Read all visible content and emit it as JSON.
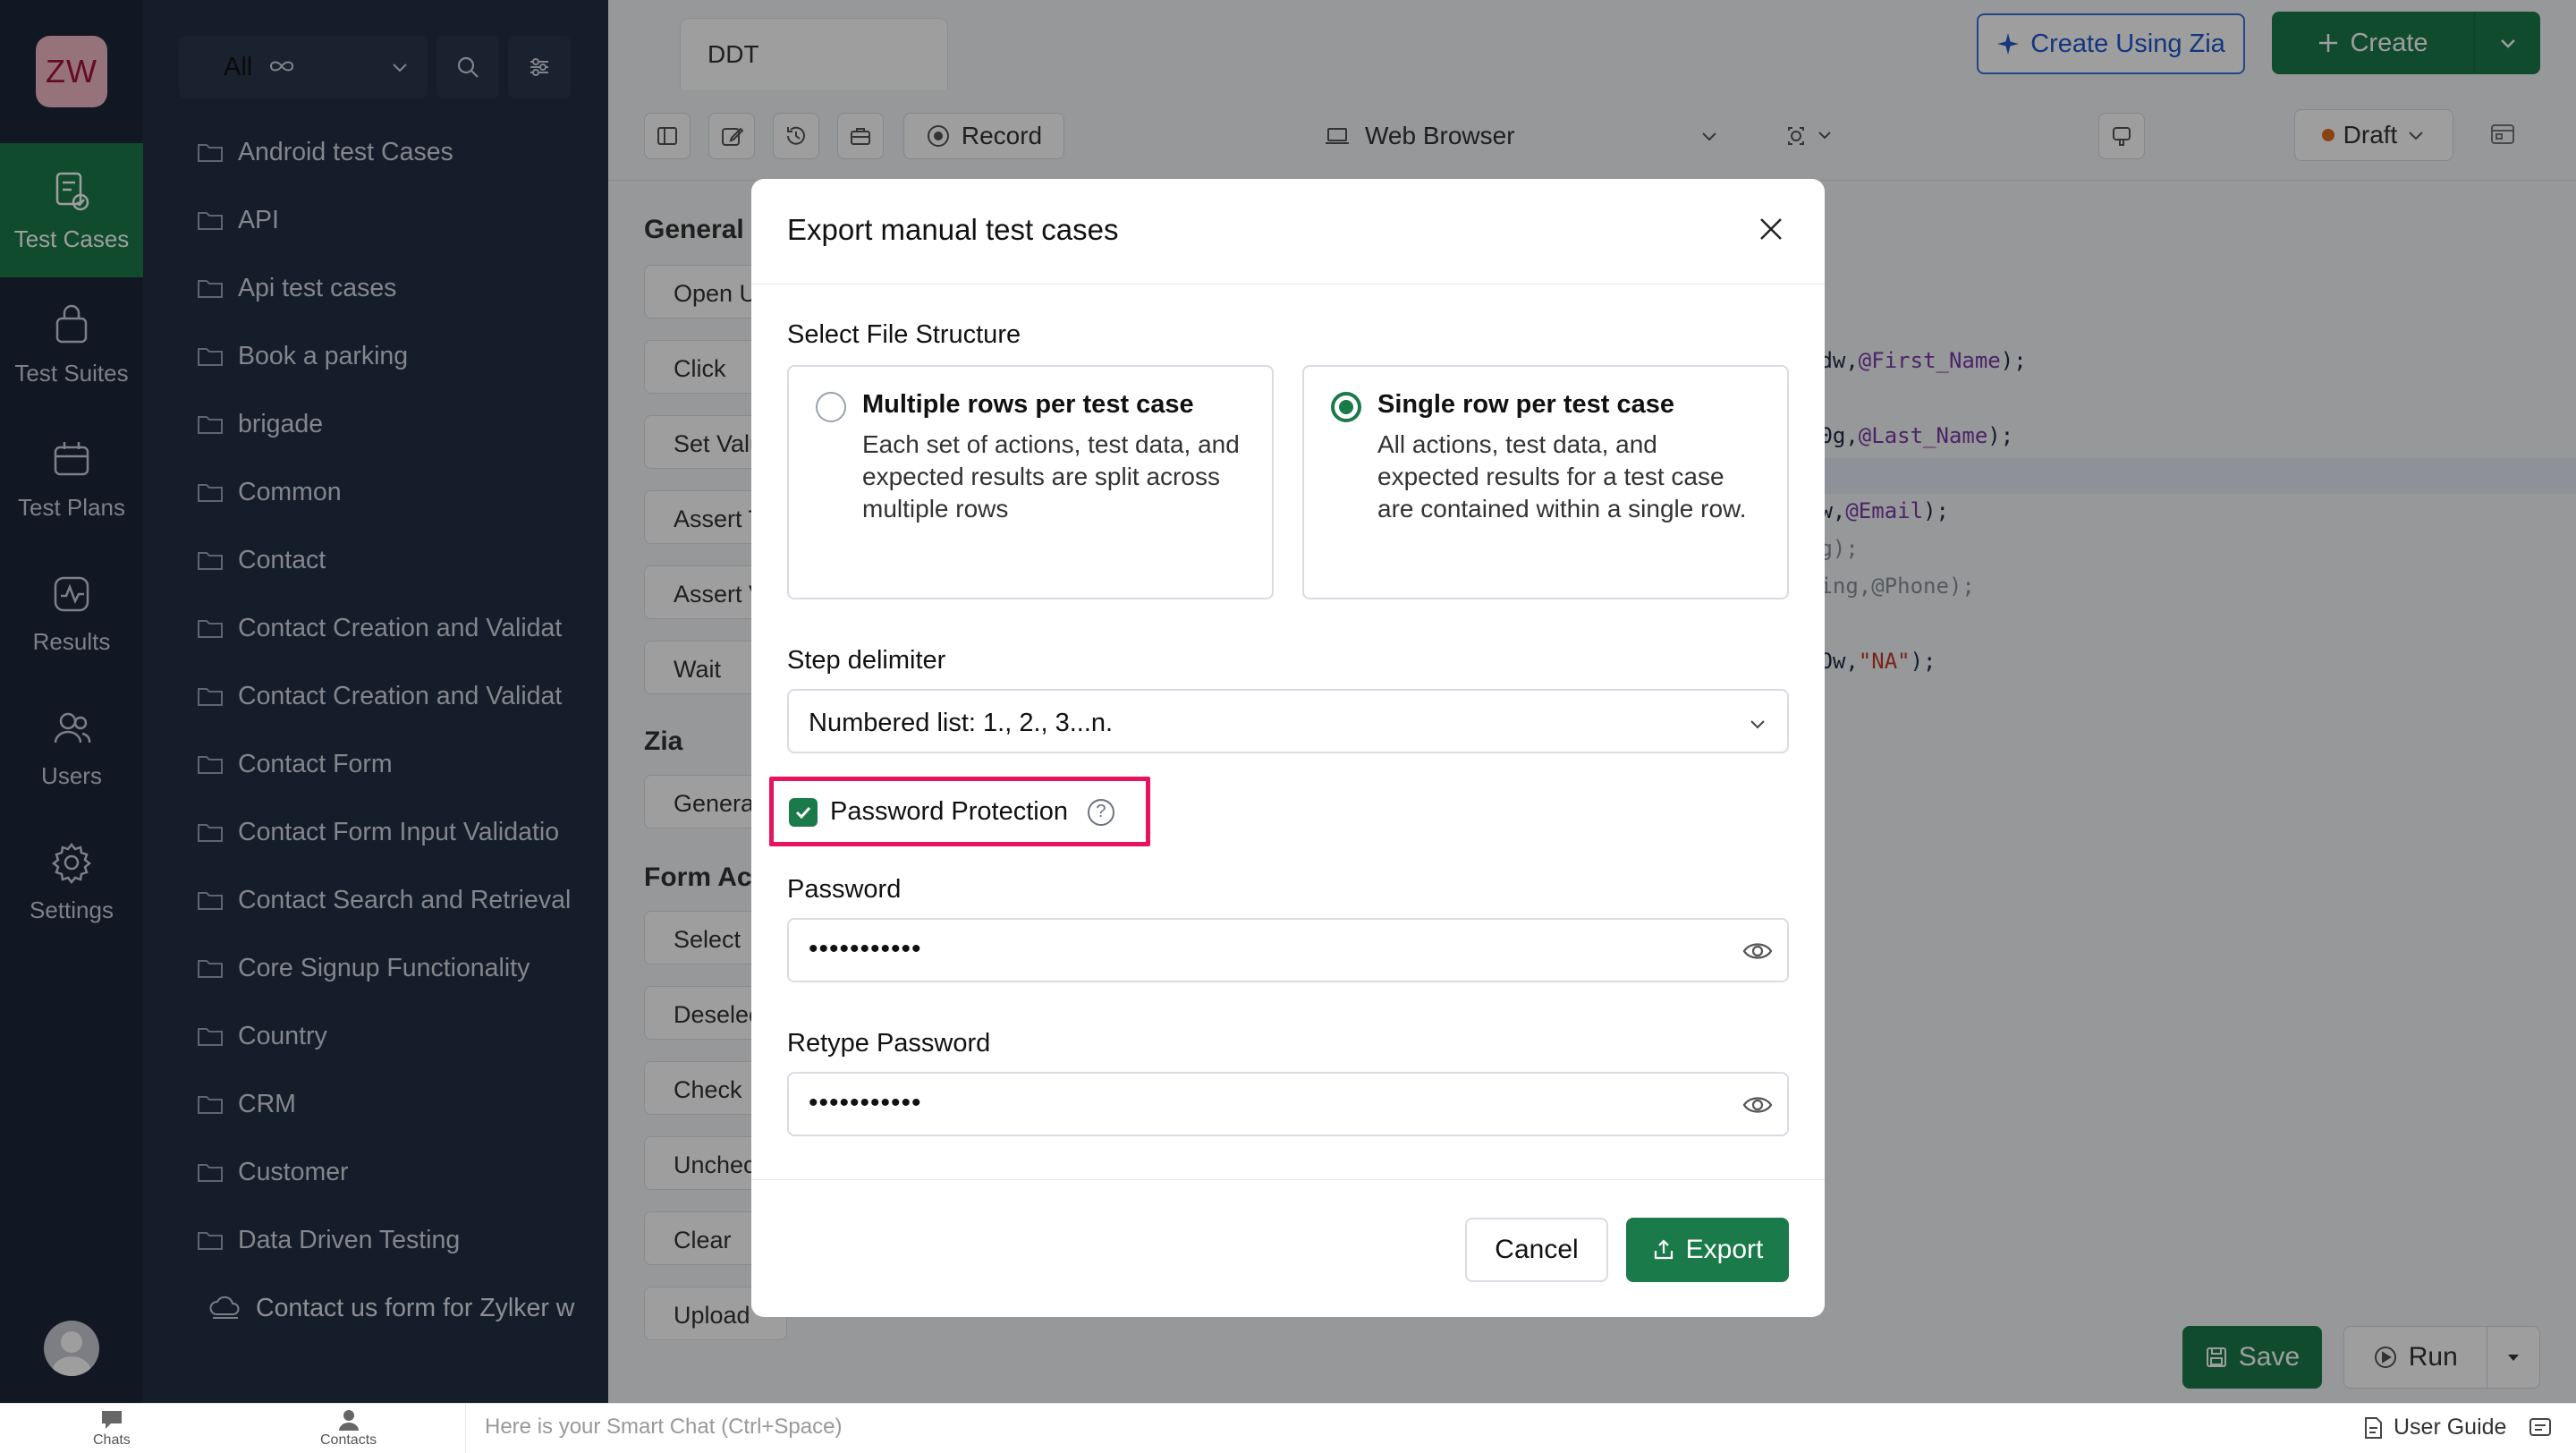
{
  "app": {
    "logo_text": "ZW"
  },
  "nav": [
    {
      "label": "Test Cases",
      "icon": "test-cases-icon",
      "active": true
    },
    {
      "label": "Test Suites",
      "icon": "test-suites-icon",
      "active": false
    },
    {
      "label": "Test Plans",
      "icon": "test-plans-icon",
      "active": false
    },
    {
      "label": "Results",
      "icon": "results-icon",
      "active": false
    },
    {
      "label": "Users",
      "icon": "users-icon",
      "active": false
    },
    {
      "label": "Settings",
      "icon": "gear-icon",
      "active": false
    }
  ],
  "sidebar": {
    "filter_label": "All",
    "folders": [
      "Android test Cases",
      "API",
      "Api test cases",
      "Book a parking",
      "brigade",
      "Common",
      "Contact",
      "Contact Creation and Validat",
      "Contact Creation and Validat",
      "Contact Form",
      "Contact Form Input Validatio",
      "Contact Search and Retrieval",
      "Core Signup Functionality",
      "Country",
      "CRM",
      "Customer",
      "Data Driven Testing"
    ],
    "subitem": "Contact us form for Zylker w"
  },
  "editor": {
    "tab_title": "DDT",
    "create_zia_label": "Create Using Zia",
    "create_label": "Create",
    "record_label": "Record",
    "platform_label": "Web Browser",
    "status_label": "Draft",
    "sections": {
      "general": "General",
      "zia": "Zia",
      "form_actions": "Form Act"
    },
    "general_actions": [
      "Open U",
      "Click",
      "Set Valu",
      "Assert T",
      "Assert V",
      "Wait"
    ],
    "zia_actions": [
      "Genera"
    ],
    "form_actions": [
      "Select",
      "Deselec",
      "Check",
      "Unchec",
      "Clear",
      "Upload"
    ],
    "save_label": "Save",
    "run_label": "Run"
  },
  "modal": {
    "title": "Export manual test cases",
    "file_structure_label": "Select File Structure",
    "options": [
      {
        "title": "Multiple rows per test case",
        "description": "Each set of actions, test data, and expected results are split across multiple rows",
        "selected": false
      },
      {
        "title": "Single row per test case",
        "description": "All actions, test data, and expected results for a test case are contained within a single row.",
        "selected": true
      }
    ],
    "delimiter_label": "Step delimiter",
    "delimiter_value": "Numbered list: 1., 2., 3...n.",
    "password_protection_label": "Password Protection",
    "password_protection_checked": true,
    "password_label": "Password",
    "password_value": "•••••••••••",
    "retype_password_label": "Retype Password",
    "retype_password_value": "•••••••••••",
    "cancel_label": "Cancel",
    "export_label": "Export"
  },
  "chatbar": {
    "chats_label": "Chats",
    "contacts_label": "Contacts",
    "input_placeholder": "Here is your Smart Chat (Ctrl+Space)",
    "user_guide_label": "User Guide"
  },
  "colors": {
    "primary_green": "#1b7a4a",
    "rail_bg": "#1c2639",
    "sidebar_bg": "#232e44",
    "highlight_pink": "#e8135f",
    "zia_blue": "#1f58cc"
  }
}
